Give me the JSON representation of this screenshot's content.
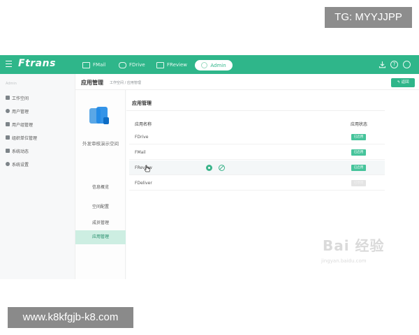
{
  "overlay": {
    "tg_badge": "TG: MYYJJPP",
    "url_badge": "www.k8kfgjb-k8.com"
  },
  "topbar": {
    "logo": "Ftrans",
    "tabs": [
      {
        "label": "FMail",
        "icon": "mail-icon"
      },
      {
        "label": "FDrive",
        "icon": "cloud-icon"
      },
      {
        "label": "FReview",
        "icon": "calendar-icon"
      },
      {
        "label": "Admin",
        "icon": "admin-icon",
        "active": true
      }
    ],
    "right_icons": [
      "download-icon",
      "help-icon",
      "user-icon"
    ],
    "color": "#2fb68a"
  },
  "sidebar": {
    "section_label": "Admin",
    "items": [
      {
        "label": "工作空间",
        "icon": "workspace-icon"
      },
      {
        "label": "用户管理",
        "icon": "user-icon"
      },
      {
        "label": "用户组管理",
        "icon": "group-icon"
      },
      {
        "label": "组织单位管理",
        "icon": "org-icon"
      },
      {
        "label": "系统动态",
        "icon": "activity-icon"
      },
      {
        "label": "系统设置",
        "icon": "settings-icon"
      }
    ]
  },
  "header": {
    "title": "应用管理",
    "breadcrumb": "工作空间 / 应用管理",
    "back_button": "↰ 返回"
  },
  "subnav": {
    "org_name": "外发审核演示空间",
    "items": [
      {
        "label": "信息概览"
      },
      {
        "label": "空间配置"
      },
      {
        "label": "成员管理"
      },
      {
        "label": "应用管理",
        "active": true
      }
    ]
  },
  "panel": {
    "title": "应用管理",
    "columns": {
      "name": "应用名称",
      "status": "应用状态"
    },
    "rows": [
      {
        "name": "FDrive",
        "status": "已启用",
        "enabled": true
      },
      {
        "name": "FMail",
        "status": "已启用",
        "enabled": true
      },
      {
        "name": "FReview",
        "status": "已启用",
        "enabled": true,
        "hover": true
      },
      {
        "name": "FDeliver",
        "status": "已停用",
        "enabled": false
      }
    ]
  },
  "watermark": {
    "text": "Bai 经验",
    "sub": "jingyan.baidu.com"
  }
}
